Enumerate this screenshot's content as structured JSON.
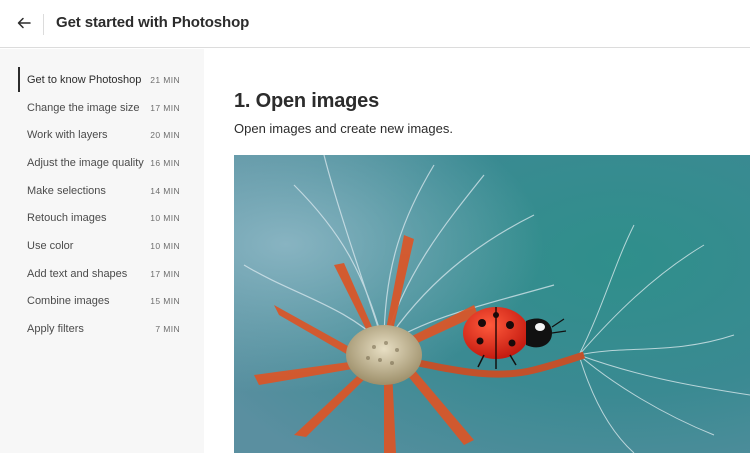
{
  "header": {
    "title": "Get started with Photoshop",
    "back_icon": "arrow-left-icon"
  },
  "sidebar": {
    "items": [
      {
        "label": "Get to know Photoshop",
        "duration": "21 MIN",
        "active": true
      },
      {
        "label": "Change the image size",
        "duration": "17 MIN"
      },
      {
        "label": "Work with layers",
        "duration": "20 MIN"
      },
      {
        "label": "Adjust the image quality",
        "duration": "16 MIN"
      },
      {
        "label": "Make selections",
        "duration": "14 MIN"
      },
      {
        "label": "Retouch images",
        "duration": "10 MIN"
      },
      {
        "label": "Use color",
        "duration": "10 MIN"
      },
      {
        "label": "Add text and shapes",
        "duration": "17 MIN"
      },
      {
        "label": "Combine images",
        "duration": "15 MIN"
      },
      {
        "label": "Apply filters",
        "duration": "7 MIN"
      }
    ]
  },
  "main": {
    "title": "1. Open images",
    "subtitle": "Open images and create new images."
  },
  "colors": {
    "text": "#2c2c2c",
    "sidebar_bg": "#f7f7f7",
    "divider": "#dcdcdc",
    "image_teal": "#2e8e8a"
  }
}
